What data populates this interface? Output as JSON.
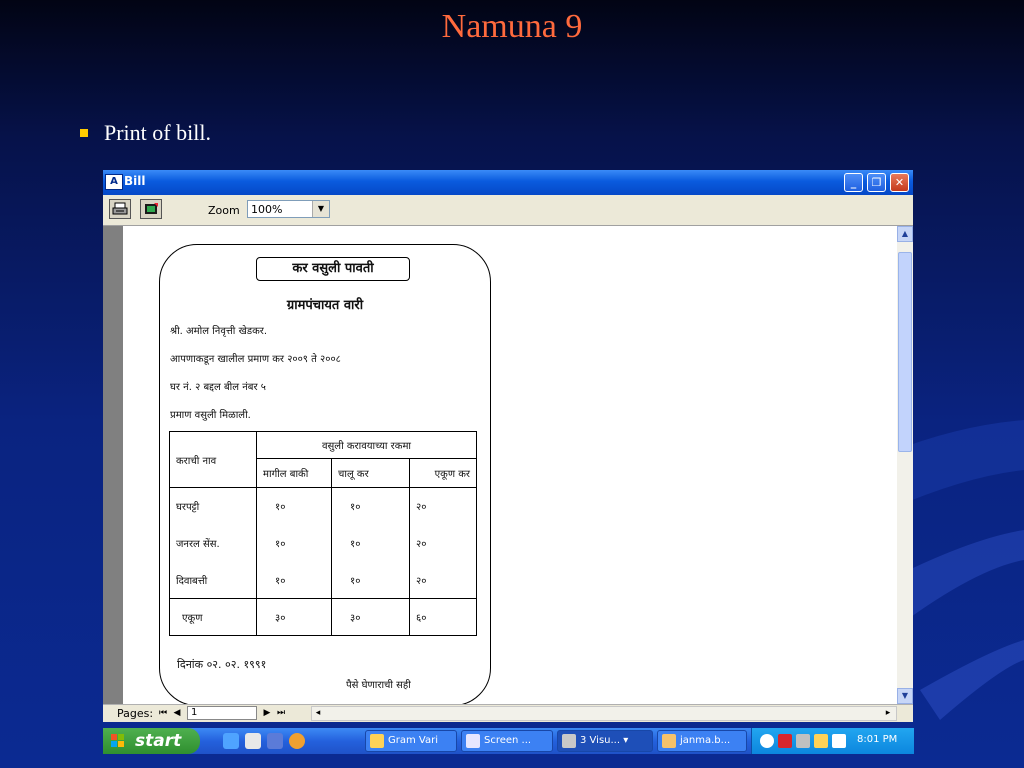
{
  "slide": {
    "title": "Namuna 9",
    "bullets": [
      "Print of bill."
    ]
  },
  "window": {
    "title": "Bill",
    "buttons": {
      "minimize": "_",
      "restore": "❐",
      "close": "✕"
    },
    "toolbar": {
      "zoom_label": "Zoom",
      "zoom_value": "100%"
    },
    "status": {
      "pages_label": "Pages:",
      "page_value": "1"
    }
  },
  "receipt": {
    "title": "कर वसुली पावती",
    "subtitle": "ग्रामपंचायत वारी",
    "lines": [
      "श्री.   अमोल निवृत्ती खेडकर.",
      "आपणाकडून खालील प्रमाण कर  २००९  ते २००८",
      " घर नं. २                  बद्दल बील नंबर ५",
      "प्रमाण वसुली मिळाली."
    ],
    "table": {
      "col_tax_name": "कराची नाव",
      "group_header": "वसुली करावयाच्या रकमा",
      "col_previous": "मागील बाकी",
      "col_current": "चालू कर",
      "col_total": "एकूण कर",
      "rows": [
        {
          "name": "घरपट्टी",
          "previous": "१०",
          "current": "१०",
          "total": "२०"
        },
        {
          "name": "जनरल सेंस.",
          "previous": "१०",
          "current": "१०",
          "total": "२०"
        },
        {
          "name": "दिवाबत्ती",
          "previous": "१०",
          "current": "१०",
          "total": "२०"
        }
      ],
      "total_row": {
        "name": "एकूण",
        "previous": "३०",
        "current": "३०",
        "total": "६०"
      }
    },
    "date_line": "दिनांक  ०२. ०२. १९९१",
    "signature": "पैसे घेणाराची सही"
  },
  "taskbar": {
    "start_label": "start",
    "tasks": [
      {
        "label": "Gram Vari"
      },
      {
        "label": "Screen ..."
      },
      {
        "label": "3 Visu...  ▾"
      },
      {
        "label": "janma.b..."
      }
    ],
    "clock": "8:01 PM"
  }
}
